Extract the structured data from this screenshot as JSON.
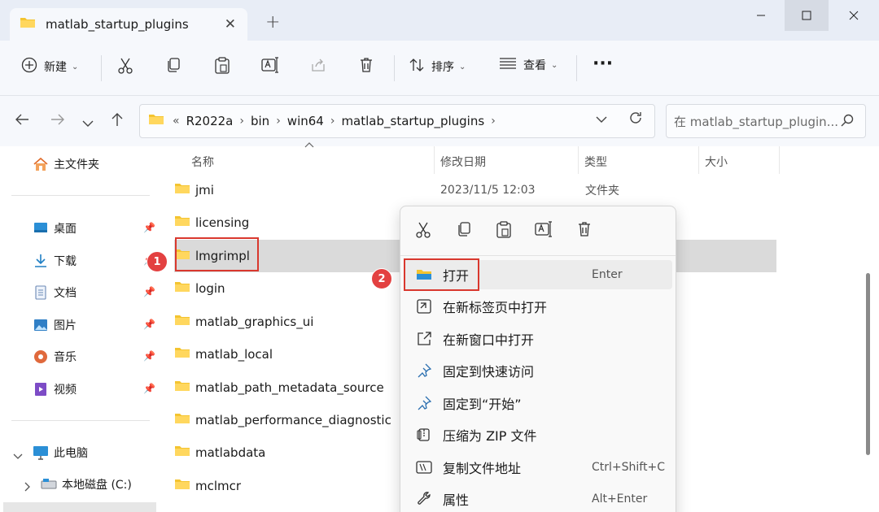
{
  "window": {
    "tab_title": "matlab_startup_plugins",
    "tab_close": "✕",
    "new_tab": "+"
  },
  "toolbar": {
    "new_label": "新建",
    "sort_label": "排序",
    "view_label": "查看",
    "more": "···"
  },
  "address": {
    "overflow": "«",
    "crumbs": [
      "R2022a",
      "bin",
      "win64",
      "matlab_startup_plugins"
    ],
    "search_placeholder": "在 matlab_startup_plugin..."
  },
  "sidebar": {
    "home": "主文件夹",
    "quick": [
      "桌面",
      "下载",
      "文档",
      "图片",
      "音乐",
      "视频"
    ],
    "this_pc": "此电脑",
    "drive_c": "本地磁盘 (C:)"
  },
  "columns": {
    "name": "名称",
    "modified": "修改日期",
    "type": "类型",
    "size": "大小"
  },
  "files": [
    {
      "name": "jmi",
      "date": "2023/11/5 12:03",
      "type": "文件夹"
    },
    {
      "name": "licensing",
      "date": "",
      "type": ""
    },
    {
      "name": "lmgrimpl",
      "date": "",
      "type": ""
    },
    {
      "name": "login",
      "date": "",
      "type": ""
    },
    {
      "name": "matlab_graphics_ui",
      "date": "",
      "type": ""
    },
    {
      "name": "matlab_local",
      "date": "",
      "type": ""
    },
    {
      "name": "matlab_path_metadata_source",
      "date": "",
      "type": ""
    },
    {
      "name": "matlab_performance_diagnostic",
      "date": "",
      "type": ""
    },
    {
      "name": "matlabdata",
      "date": "",
      "type": ""
    },
    {
      "name": "mclmcr",
      "date": "",
      "type": ""
    }
  ],
  "badges": {
    "one": "1",
    "two": "2"
  },
  "context_menu": {
    "items": [
      {
        "label": "打开",
        "key": "Enter"
      },
      {
        "label": "在新标签页中打开",
        "key": ""
      },
      {
        "label": "在新窗口中打开",
        "key": ""
      },
      {
        "label": "固定到快速访问",
        "key": ""
      },
      {
        "label": "固定到“开始”",
        "key": ""
      },
      {
        "label": "压缩为 ZIP 文件",
        "key": ""
      },
      {
        "label": "复制文件地址",
        "key": "Ctrl+Shift+C"
      },
      {
        "label": "属性",
        "key": "Alt+Enter"
      }
    ]
  },
  "colors": {
    "folder": "#f4c430",
    "highlight": "#d9382e",
    "selected_row": "#dadada"
  }
}
